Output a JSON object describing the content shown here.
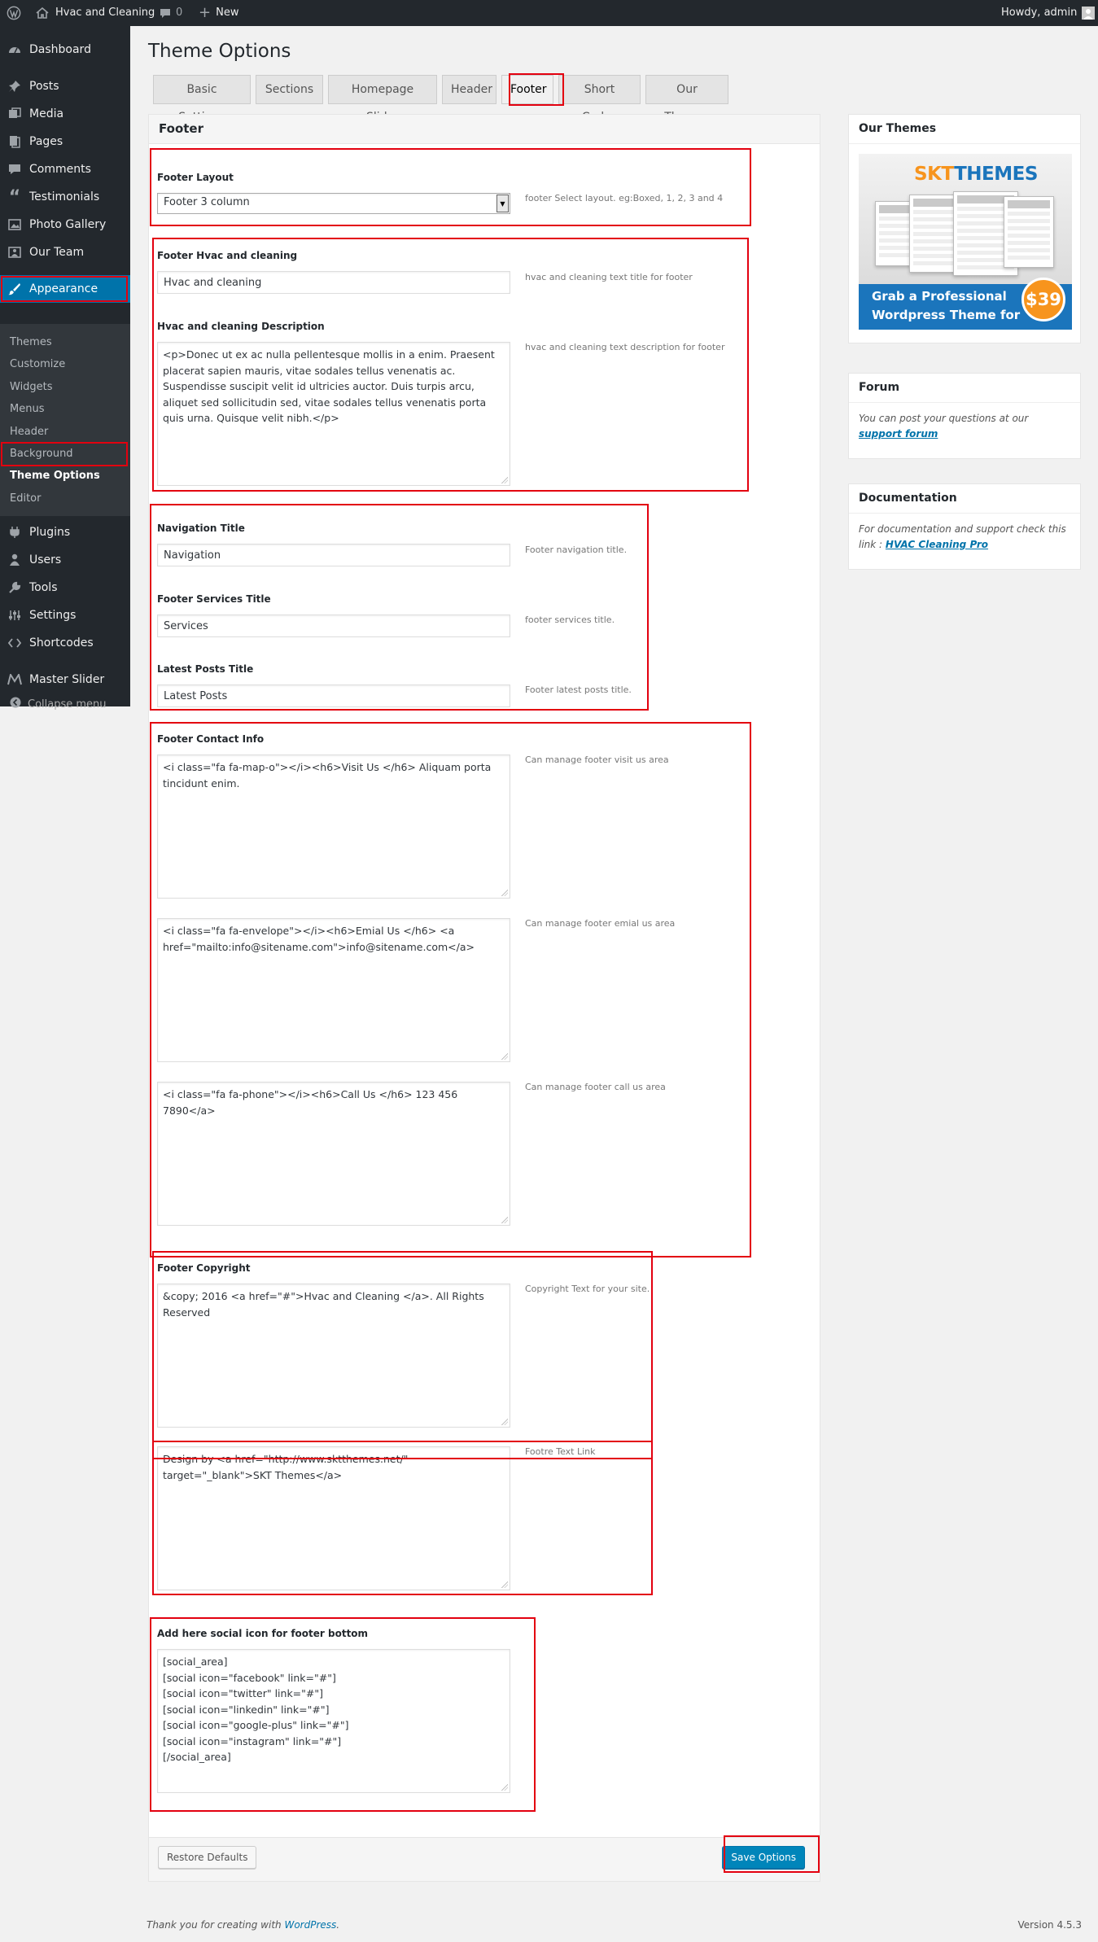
{
  "adminbar": {
    "site_name": "Hvac and Cleaning",
    "comments_count": "0",
    "new_label": "New",
    "howdy": "Howdy, admin"
  },
  "menu": {
    "items": [
      {
        "label": "Dashboard",
        "icon": "dashboard-icon"
      },
      {
        "label": "Posts",
        "icon": "pin-icon"
      },
      {
        "label": "Media",
        "icon": "media-icon"
      },
      {
        "label": "Pages",
        "icon": "page-icon"
      },
      {
        "label": "Comments",
        "icon": "comment-icon"
      },
      {
        "label": "Testimonials",
        "icon": "quote-icon"
      },
      {
        "label": "Photo Gallery",
        "icon": "gallery-icon"
      },
      {
        "label": "Our Team",
        "icon": "team-icon"
      },
      {
        "label": "Appearance",
        "icon": "brush-icon"
      },
      {
        "label": "Plugins",
        "icon": "plugin-icon"
      },
      {
        "label": "Users",
        "icon": "user-icon"
      },
      {
        "label": "Tools",
        "icon": "wrench-icon"
      },
      {
        "label": "Settings",
        "icon": "settings-icon"
      },
      {
        "label": "Shortcodes",
        "icon": "code-icon"
      },
      {
        "label": "Master Slider",
        "icon": "slider-icon"
      }
    ],
    "submenu": [
      "Themes",
      "Customize",
      "Widgets",
      "Menus",
      "Header",
      "Background",
      "Theme Options",
      "Editor"
    ],
    "collapse": "Collapse menu"
  },
  "page": {
    "title": "Theme Options",
    "tabs": [
      "Basic Settings",
      "Sections",
      "Homepage Slider",
      "Header",
      "Footer",
      "Short Codes",
      "Our Themes"
    ],
    "active_tab": "Footer"
  },
  "panel": {
    "title": "Footer",
    "footer_layout": {
      "label": "Footer Layout",
      "value": "Footer 3 column",
      "desc": "footer Select layout. eg:Boxed, 1, 2, 3 and 4"
    },
    "hvac_title": {
      "label": "Footer Hvac and cleaning",
      "value": "Hvac and cleaning",
      "desc": "hvac and cleaning text title for footer"
    },
    "hvac_desc": {
      "label": "Hvac and cleaning Description",
      "value": "<p>Donec ut ex ac nulla pellentesque mollis in a enim. Praesent placerat sapien mauris, vitae sodales tellus venenatis ac. Suspendisse suscipit velit id ultricies auctor. Duis turpis arcu, aliquet sed sollicitudin sed, vitae sodales tellus venenatis porta quis urna. Quisque velit nibh.</p>",
      "desc": "hvac and cleaning text description for footer"
    },
    "nav_title": {
      "label": "Navigation Title",
      "value": "Navigation",
      "desc": "Footer navigation title."
    },
    "services_title": {
      "label": "Footer Services Title",
      "value": "Services",
      "desc": "footer services title."
    },
    "posts_title": {
      "label": "Latest Posts Title",
      "value": "Latest Posts",
      "desc": "Footer latest posts title."
    },
    "contact": {
      "label": "Footer Contact Info",
      "visit_value": "<i class=\"fa fa-map-o\"></i><h6>Visit Us </h6> Aliquam porta tincidunt enim.",
      "visit_desc": "Can manage footer visit us area",
      "email_value": "<i class=\"fa fa-envelope\"></i><h6>Emial Us </h6> <a href=\"mailto:info@sitename.com\">info@sitename.com</a>",
      "email_desc": "Can manage footer emial us area",
      "call_value": "<i class=\"fa fa-phone\"></i><h6>Call Us </h6> 123 456 7890</a>",
      "call_desc": "Can manage footer call us area"
    },
    "copyright": {
      "label": "Footer Copyright",
      "value": "&copy; 2016 <a href=\"#\">Hvac and Cleaning </a>. All Rights Reserved",
      "desc": "Copyright Text for your site."
    },
    "design_link": {
      "value": "Design by <a href=\"http://www.sktthemes.net/\" target=\"_blank\">SKT Themes</a>",
      "desc": "Footre Text Link"
    },
    "social": {
      "label": "Add here social icon for footer bottom",
      "value": "[social_area]\n[social icon=\"facebook\" link=\"#\"]\n[social icon=\"twitter\" link=\"#\"]\n[social icon=\"linkedin\" link=\"#\"]\n[social icon=\"google-plus\" link=\"#\"]\n[social icon=\"instagram\" link=\"#\"]\n[/social_area]"
    },
    "restore_label": "Restore Defaults",
    "save_label": "Save Options"
  },
  "sidebar": {
    "themes_title": "Our Themes",
    "promo": {
      "logo_a": "SKT",
      "logo_b": "THEMES",
      "line1": "Grab a Professional",
      "line2": "Wordpress Theme for",
      "price": "$39"
    },
    "forum_title": "Forum",
    "forum_text": "You can post your questions at our ",
    "forum_link": "support forum",
    "doc_title": "Documentation",
    "doc_text": "For documentation and support check this link : ",
    "doc_link": "HVAC Cleaning Pro"
  },
  "footer": {
    "thanks": "Thank you for creating with ",
    "wp_link": "WordPress",
    "thanks_end": ".",
    "version": "Version 4.5.3"
  },
  "colors": {
    "accent": "#0073aa",
    "annotation": "#e3000f"
  }
}
